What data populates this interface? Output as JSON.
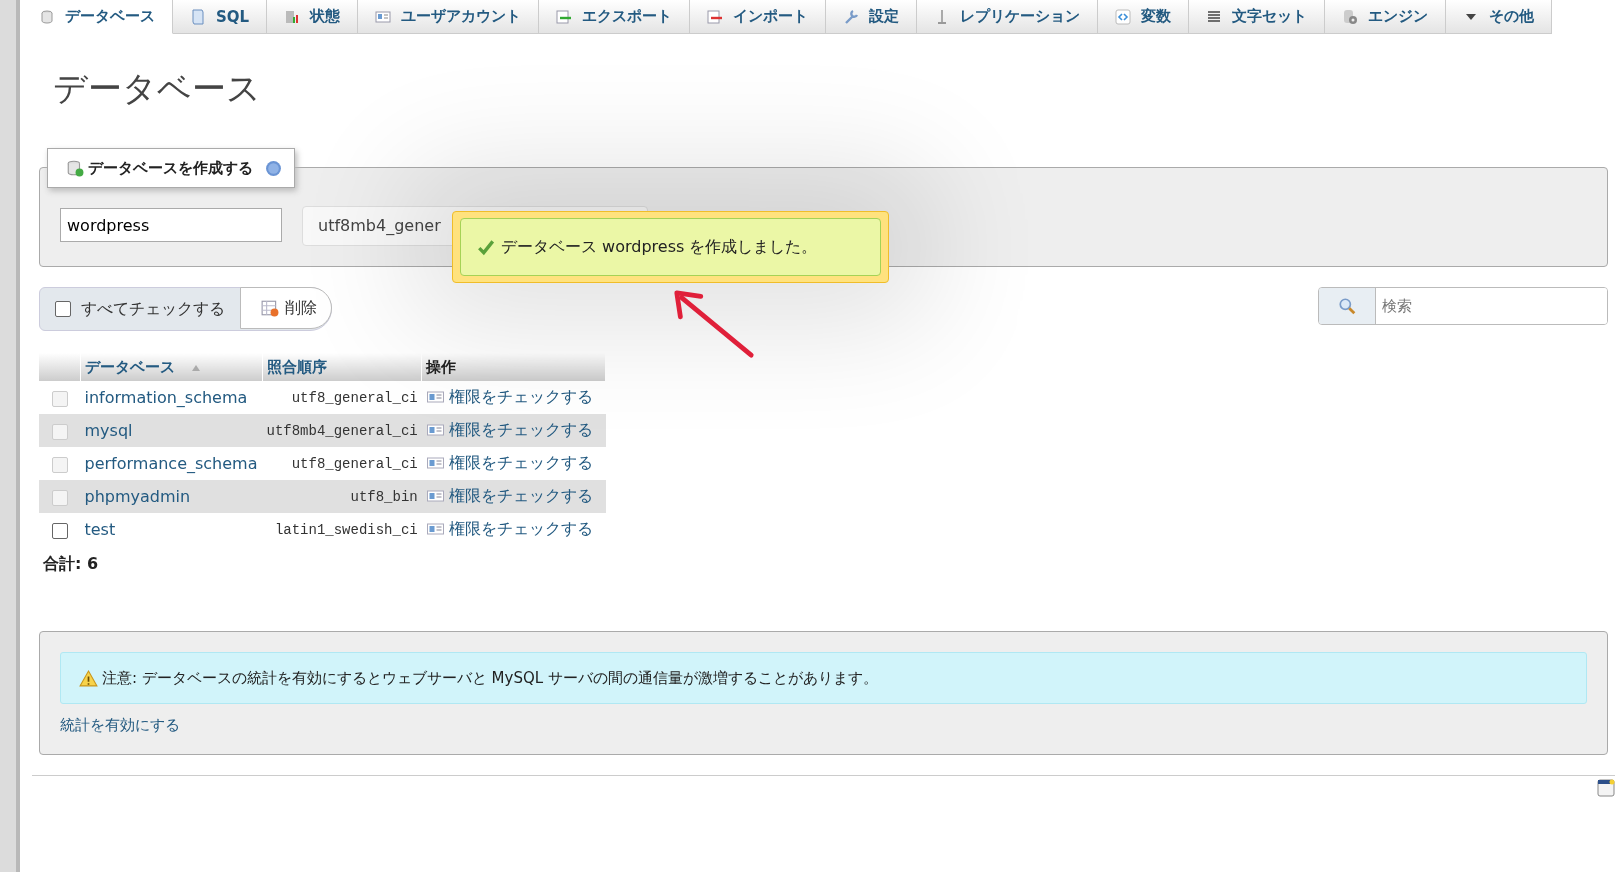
{
  "tabs": [
    {
      "label": "データベース",
      "selected": true
    },
    {
      "label": "SQL",
      "selected": false
    },
    {
      "label": "状態",
      "selected": false
    },
    {
      "label": "ユーザアカウント",
      "selected": false
    },
    {
      "label": "エクスポート",
      "selected": false
    },
    {
      "label": "インポート",
      "selected": false
    },
    {
      "label": "設定",
      "selected": false
    },
    {
      "label": "レプリケーション",
      "selected": false
    },
    {
      "label": "変数",
      "selected": false
    },
    {
      "label": "文字セット",
      "selected": false
    },
    {
      "label": "エンジン",
      "selected": false
    },
    {
      "label": "その他",
      "selected": false
    }
  ],
  "heading": "データベース",
  "create_database": {
    "legend": "データベースを作成する",
    "name_value": "wordpress",
    "collation_value": "utf8mb4_gener"
  },
  "notification": {
    "message": "データベース wordpress を作成しました。"
  },
  "toolbar": {
    "check_all_label": "すべてチェックする",
    "check_all_checked": false,
    "delete_button": "削除"
  },
  "search": {
    "placeholder": "検索"
  },
  "table": {
    "columns": [
      {
        "label": "データベース",
        "sorted": true
      },
      {
        "label": "照合順序",
        "sorted": false
      },
      {
        "label": "操作",
        "sorted": false
      }
    ],
    "rows": [
      {
        "name": "information_schema",
        "collation": "utf8_general_ci",
        "action": "権限をチェックする",
        "checked": false,
        "disabled": true
      },
      {
        "name": "mysql",
        "collation": "utf8mb4_general_ci",
        "action": "権限をチェックする",
        "checked": false,
        "disabled": true
      },
      {
        "name": "performance_schema",
        "collation": "utf8_general_ci",
        "action": "権限をチェックする",
        "checked": false,
        "disabled": true
      },
      {
        "name": "phpmyadmin",
        "collation": "utf8_bin",
        "action": "権限をチェックする",
        "checked": false,
        "disabled": true
      },
      {
        "name": "test",
        "collation": "latin1_swedish_ci",
        "action": "権限をチェックする",
        "checked": false,
        "disabled": false
      }
    ]
  },
  "total": "合計: 6",
  "notice": {
    "message": "注意: データベースの統計を有効にするとウェブサーバと MySQL サーバの間の通信量が激増することがあります。",
    "link": "統計を有効にする"
  }
}
